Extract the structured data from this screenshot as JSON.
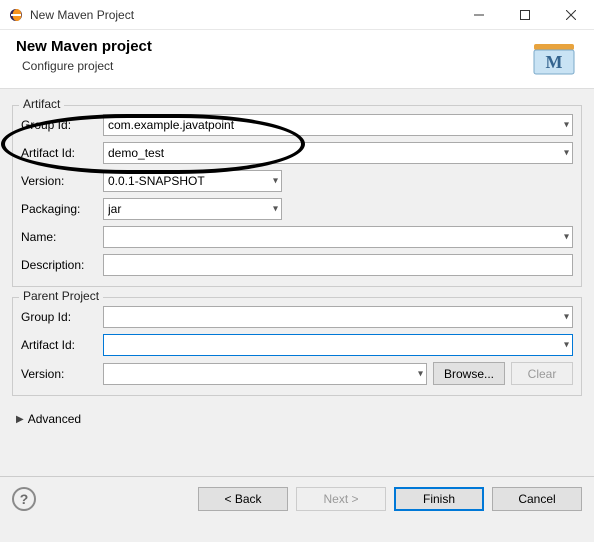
{
  "window": {
    "title": "New Maven Project"
  },
  "header": {
    "title": "New Maven project",
    "subtitle": "Configure project"
  },
  "artifact": {
    "legend": "Artifact",
    "labels": {
      "groupId": "Group Id:",
      "artifactId": "Artifact Id:",
      "version": "Version:",
      "packaging": "Packaging:",
      "name": "Name:",
      "description": "Description:"
    },
    "values": {
      "groupId": "com.example.javatpoint",
      "artifactId": "demo_test",
      "version": "0.0.1-SNAPSHOT",
      "packaging": "jar",
      "name": "",
      "description": ""
    }
  },
  "parent": {
    "legend": "Parent Project",
    "labels": {
      "groupId": "Group Id:",
      "artifactId": "Artifact Id:",
      "version": "Version:"
    },
    "values": {
      "groupId": "",
      "artifactId": "",
      "version": ""
    },
    "buttons": {
      "browse": "Browse...",
      "clear": "Clear"
    }
  },
  "advanced": {
    "label": "Advanced"
  },
  "buttons": {
    "back": "< Back",
    "next": "Next >",
    "finish": "Finish",
    "cancel": "Cancel"
  }
}
